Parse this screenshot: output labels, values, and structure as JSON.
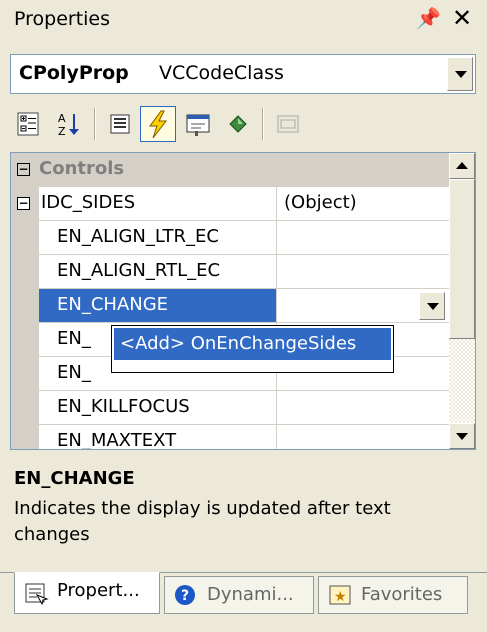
{
  "window": {
    "title": "Properties"
  },
  "object_combo": {
    "name": "CPolyProp",
    "type": "VCCodeClass"
  },
  "toolbar": {
    "buttons": [
      {
        "icon": "categorized-icon",
        "active": false
      },
      {
        "icon": "alphabetical-icon",
        "active": false
      },
      {
        "icon": "properties-icon",
        "active": false
      },
      {
        "icon": "events-icon",
        "active": true
      },
      {
        "icon": "messages-icon",
        "active": false
      },
      {
        "icon": "overrides-icon",
        "active": false
      },
      {
        "icon": "property-pages-icon",
        "active": false
      }
    ]
  },
  "grid": {
    "category": "Controls",
    "group": {
      "name": "IDC_SIDES",
      "value": "(Object)"
    },
    "events": [
      {
        "name": "EN_ALIGN_LTR_EC",
        "value": ""
      },
      {
        "name": "EN_ALIGN_RTL_EC",
        "value": ""
      },
      {
        "name": "EN_CHANGE",
        "value": "",
        "selected": true
      },
      {
        "name": "EN_",
        "value": ""
      },
      {
        "name": "EN_",
        "value": ""
      },
      {
        "name": "EN_KILLFOCUS",
        "value": ""
      },
      {
        "name": "EN_MAXTEXT",
        "value": ""
      }
    ]
  },
  "dropdown_list": {
    "item": "<Add> OnEnChangeSides"
  },
  "description": {
    "title": "EN_CHANGE",
    "text": "Indicates the display is updated after text changes"
  },
  "tabs": [
    {
      "label": "Propert...",
      "icon": "property-sheet-icon",
      "active": true
    },
    {
      "label": "Dynami...",
      "icon": "help-icon",
      "active": false
    },
    {
      "label": "Favorites",
      "icon": "favorites-icon",
      "active": false
    }
  ],
  "colors": {
    "selection": "#316ac5",
    "face": "#ece9d8",
    "border": "#7f9db9"
  }
}
